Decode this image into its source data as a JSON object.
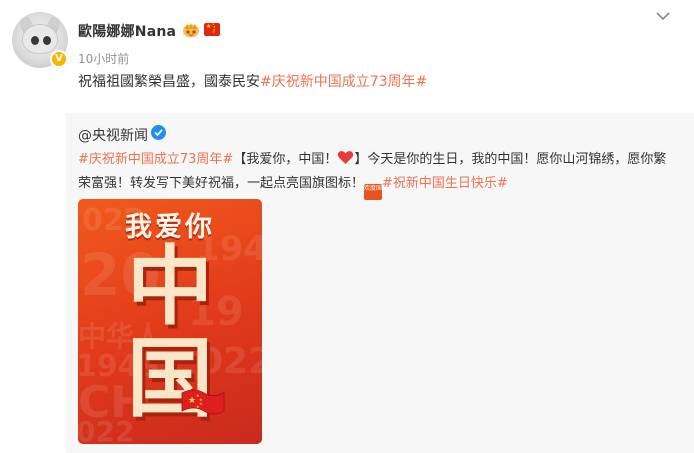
{
  "post": {
    "author": "歐陽娜娜Nana",
    "verified_badge": "V",
    "time": "10小时前",
    "text_plain": "祝福祖國繁榮昌盛，國泰民安",
    "text_tag": "#庆祝新中国成立73周年#"
  },
  "repost": {
    "author": "@央视新闻",
    "line1": {
      "tag": "#庆祝新中国成立73周年#",
      "text_a": "【我爱你，中国！",
      "text_b": "】今天是你的生日，我的中国！愿你山河锦绣，愿你繁"
    },
    "line2": {
      "text": "荣富强！转发写下美好祝福，一起点亮国旗图标！",
      "stamp_text": "欢度国庆",
      "tag": "#祝新中国生日快乐#"
    }
  },
  "poster": {
    "headline": "我爱你",
    "char_1": "中",
    "char_2": "国"
  },
  "colors": {
    "tag": "#eb7350",
    "poster_red": "#e0391b",
    "verified_blue": "#1f8ff0",
    "vip_gold": "#f7b500"
  },
  "icons": [
    "crown-icon",
    "china-flag-icon",
    "chevron-down-icon",
    "verified-icon",
    "heart-icon",
    "national-day-stamp-icon",
    "poster-flag-icon"
  ]
}
